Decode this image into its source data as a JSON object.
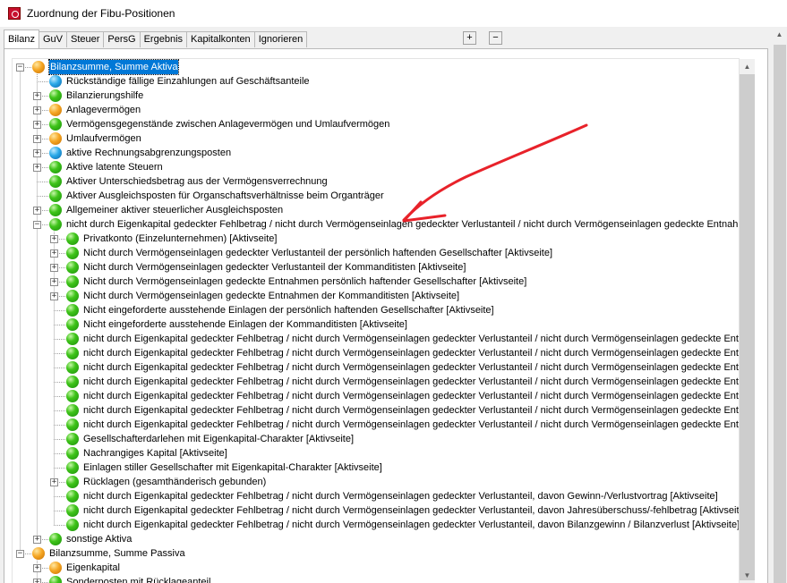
{
  "window": {
    "title": "Zuordnung der Fibu-Positionen",
    "app_icon": "app-icon"
  },
  "tabs": [
    {
      "label": "Bilanz",
      "active": true
    },
    {
      "label": "GuV"
    },
    {
      "label": "Steuer"
    },
    {
      "label": "PersG"
    },
    {
      "label": "Ergebnis"
    },
    {
      "label": "Kapitalkonten"
    },
    {
      "label": "Ignorieren"
    }
  ],
  "tab_buttons": {
    "expand": "+",
    "collapse": "−"
  },
  "colors": {
    "selection": "#0078d7",
    "annotation_arrow": "#e8222a"
  },
  "tree": [
    {
      "label": "Bilanzsumme, Summe Aktiva",
      "level": 0,
      "icon": "orange",
      "toggle": "minus",
      "selected": true
    },
    {
      "label": "Rückständige fällige Einzahlungen auf Geschäftsanteile",
      "level": 1,
      "icon": "blue",
      "toggle": "none"
    },
    {
      "label": "Bilanzierungshilfe",
      "level": 1,
      "icon": "green",
      "toggle": "plus"
    },
    {
      "label": "Anlagevermögen",
      "level": 1,
      "icon": "orange",
      "toggle": "plus"
    },
    {
      "label": "Vermögensgegenstände zwischen Anlagevermögen und Umlaufvermögen",
      "level": 1,
      "icon": "green",
      "toggle": "plus"
    },
    {
      "label": "Umlaufvermögen",
      "level": 1,
      "icon": "orange",
      "toggle": "plus"
    },
    {
      "label": "aktive Rechnungsabgrenzungsposten",
      "level": 1,
      "icon": "blue",
      "toggle": "plus"
    },
    {
      "label": "Aktive latente Steuern",
      "level": 1,
      "icon": "green",
      "toggle": "plus"
    },
    {
      "label": "Aktiver Unterschiedsbetrag aus der Vermögensverrechnung",
      "level": 1,
      "icon": "green",
      "toggle": "none"
    },
    {
      "label": "Aktiver Ausgleichsposten für Organschaftsverhältnisse beim Organträger",
      "level": 1,
      "icon": "green",
      "toggle": "none"
    },
    {
      "label": "Allgemeiner aktiver steuerlicher Ausgleichsposten",
      "level": 1,
      "icon": "green",
      "toggle": "plus"
    },
    {
      "label": "nicht durch Eigenkapital gedeckter Fehlbetrag / nicht durch Vermögenseinlagen gedeckter Verlustanteil / nicht durch Vermögenseinlagen gedeckte Entnahmen",
      "level": 1,
      "icon": "green",
      "toggle": "minus"
    },
    {
      "label": "Privatkonto (Einzelunternehmen) [Aktivseite]",
      "level": 2,
      "icon": "green",
      "toggle": "plus"
    },
    {
      "label": "Nicht durch Vermögenseinlagen gedeckter Verlustanteil der persönlich haftenden Gesellschafter [Aktivseite]",
      "level": 2,
      "icon": "green",
      "toggle": "plus"
    },
    {
      "label": "Nicht durch Vermögenseinlagen gedeckter Verlustanteil der Kommanditisten [Aktivseite]",
      "level": 2,
      "icon": "green",
      "toggle": "plus"
    },
    {
      "label": "Nicht durch Vermögenseinlagen gedeckte Entnahmen persönlich haftender Gesellschafter [Aktivseite]",
      "level": 2,
      "icon": "green",
      "toggle": "plus"
    },
    {
      "label": "Nicht durch Vermögenseinlagen gedeckte Entnahmen der Kommanditisten [Aktivseite]",
      "level": 2,
      "icon": "green",
      "toggle": "plus"
    },
    {
      "label": "Nicht eingeforderte ausstehende Einlagen der persönlich haftenden Gesellschafter [Aktivseite]",
      "level": 2,
      "icon": "green",
      "toggle": "none"
    },
    {
      "label": "Nicht eingeforderte ausstehende Einlagen der Kommanditisten [Aktivseite]",
      "level": 2,
      "icon": "green",
      "toggle": "none"
    },
    {
      "label": "nicht durch Eigenkapital gedeckter Fehlbetrag / nicht durch Vermögenseinlagen gedeckter Verlustanteil / nicht durch Vermögenseinlagen gedeckte Entnal",
      "level": 2,
      "icon": "green",
      "toggle": "none"
    },
    {
      "label": "nicht durch Eigenkapital gedeckter Fehlbetrag / nicht durch Vermögenseinlagen gedeckter Verlustanteil / nicht durch Vermögenseinlagen gedeckte Entnal",
      "level": 2,
      "icon": "green",
      "toggle": "none"
    },
    {
      "label": "nicht durch Eigenkapital gedeckter Fehlbetrag / nicht durch Vermögenseinlagen gedeckter Verlustanteil / nicht durch Vermögenseinlagen gedeckte Entnal",
      "level": 2,
      "icon": "green",
      "toggle": "none"
    },
    {
      "label": "nicht durch Eigenkapital gedeckter Fehlbetrag / nicht durch Vermögenseinlagen gedeckter Verlustanteil / nicht durch Vermögenseinlagen gedeckte Entnal",
      "level": 2,
      "icon": "green",
      "toggle": "none"
    },
    {
      "label": "nicht durch Eigenkapital gedeckter Fehlbetrag / nicht durch Vermögenseinlagen gedeckter Verlustanteil / nicht durch Vermögenseinlagen gedeckte Entnal",
      "level": 2,
      "icon": "green",
      "toggle": "none"
    },
    {
      "label": "nicht durch Eigenkapital gedeckter Fehlbetrag / nicht durch Vermögenseinlagen gedeckter Verlustanteil / nicht durch Vermögenseinlagen gedeckte Entnal",
      "level": 2,
      "icon": "green",
      "toggle": "none"
    },
    {
      "label": "nicht durch Eigenkapital gedeckter Fehlbetrag / nicht durch Vermögenseinlagen gedeckter Verlustanteil / nicht durch Vermögenseinlagen gedeckte Entnal",
      "level": 2,
      "icon": "green",
      "toggle": "none"
    },
    {
      "label": "Gesellschafterdarlehen mit Eigenkapital-Charakter [Aktivseite]",
      "level": 2,
      "icon": "green",
      "toggle": "none"
    },
    {
      "label": "Nachrangiges Kapital [Aktivseite]",
      "level": 2,
      "icon": "green",
      "toggle": "none"
    },
    {
      "label": "Einlagen stiller Gesellschafter mit Eigenkapital-Charakter [Aktivseite]",
      "level": 2,
      "icon": "green",
      "toggle": "none"
    },
    {
      "label": "Rücklagen (gesamthänderisch gebunden)",
      "level": 2,
      "icon": "green",
      "toggle": "plus"
    },
    {
      "label": "nicht durch Eigenkapital gedeckter Fehlbetrag / nicht durch Vermögenseinlagen gedeckter Verlustanteil, davon Gewinn-/Verlustvortrag [Aktivseite]",
      "level": 2,
      "icon": "green",
      "toggle": "none"
    },
    {
      "label": "nicht durch Eigenkapital gedeckter Fehlbetrag / nicht durch Vermögenseinlagen gedeckter Verlustanteil, davon Jahresüberschuss/-fehlbetrag [Aktivseite]",
      "level": 2,
      "icon": "green",
      "toggle": "none"
    },
    {
      "label": "nicht durch Eigenkapital gedeckter Fehlbetrag / nicht durch Vermögenseinlagen gedeckter Verlustanteil, davon Bilanzgewinn / Bilanzverlust [Aktivseite]",
      "level": 2,
      "icon": "green",
      "toggle": "none"
    },
    {
      "label": "sonstige Aktiva",
      "level": 1,
      "icon": "green",
      "toggle": "plus"
    },
    {
      "label": "Bilanzsumme, Summe Passiva",
      "level": 0,
      "icon": "orange",
      "toggle": "minus"
    },
    {
      "label": "Eigenkapital",
      "level": 1,
      "icon": "orange",
      "toggle": "plus"
    },
    {
      "label": "Sonderposten mit Rücklageanteil",
      "level": 1,
      "icon": "green",
      "toggle": "plus"
    }
  ]
}
